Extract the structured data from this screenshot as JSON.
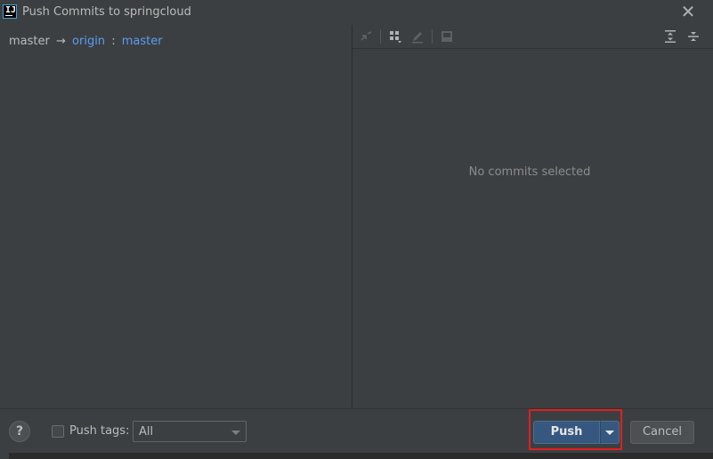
{
  "window": {
    "title": "Push Commits to springcloud",
    "close_icon": "close-icon"
  },
  "branch": {
    "local": "master",
    "arrow": "→",
    "remote": "origin",
    "separator": ":",
    "remote_branch": "master"
  },
  "toolbar": {
    "icons": [
      "cherry-pick-icon",
      "group-by-icon",
      "edit-icon",
      "diff-icon",
      "expand-all-icon",
      "collapse-all-icon"
    ]
  },
  "details": {
    "empty_message": "No commits selected"
  },
  "footer": {
    "help_label": "?",
    "push_tags_label": "Push tags:",
    "push_tags_checked": false,
    "tags_value": "All",
    "push_label": "Push",
    "cancel_label": "Cancel"
  },
  "colors": {
    "background": "#3c3f41",
    "link": "#589df6",
    "primary_button": "#365880",
    "highlight": "#e02020"
  }
}
